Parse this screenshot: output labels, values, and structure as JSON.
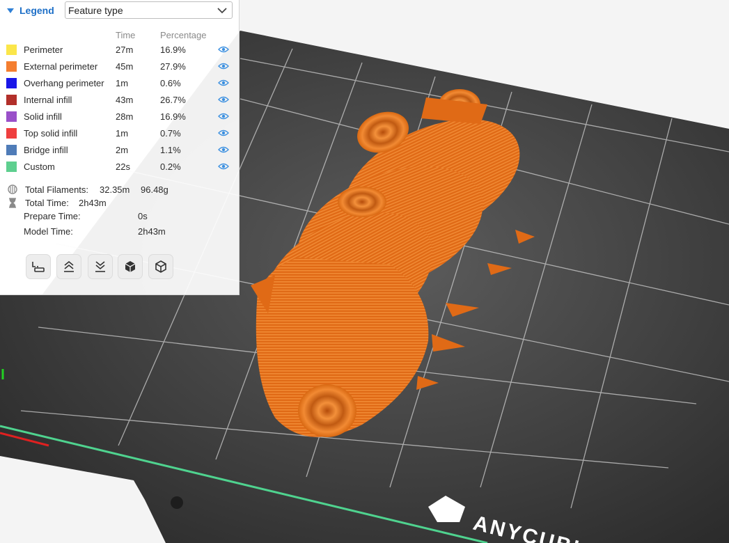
{
  "legend": {
    "title": "Legend",
    "view_type": "Feature type",
    "columns": {
      "time": "Time",
      "percentage": "Percentage"
    },
    "features": [
      {
        "name": "Perimeter",
        "time": "27m",
        "percent": "16.9%",
        "color": "#fbe64a"
      },
      {
        "name": "External perimeter",
        "time": "45m",
        "percent": "27.9%",
        "color": "#f47e2f"
      },
      {
        "name": "Overhang perimeter",
        "time": "1m",
        "percent": "0.6%",
        "color": "#1a16e8"
      },
      {
        "name": "Internal infill",
        "time": "43m",
        "percent": "26.7%",
        "color": "#b22f2a"
      },
      {
        "name": "Solid infill",
        "time": "28m",
        "percent": "16.9%",
        "color": "#9a50c9"
      },
      {
        "name": "Top solid infill",
        "time": "1m",
        "percent": "0.7%",
        "color": "#ef3f3f"
      },
      {
        "name": "Bridge infill",
        "time": "2m",
        "percent": "1.1%",
        "color": "#4f7cb8"
      },
      {
        "name": "Custom",
        "time": "22s",
        "percent": "0.2%",
        "color": "#5ecf8f"
      }
    ],
    "stats": {
      "filaments_label": "Total Filaments:",
      "filaments_length": "32.35m",
      "filaments_weight": "96.48g",
      "total_time_label": "Total Time:",
      "total_time": "2h43m",
      "prepare_time_label": "Prepare Time:",
      "prepare_time": "0s",
      "model_time_label": "Model Time:",
      "model_time": "2h43m"
    },
    "tools": [
      {
        "name": "layer-travel-icon"
      },
      {
        "name": "collapse-up-icon"
      },
      {
        "name": "expand-down-icon"
      },
      {
        "name": "solid-cube-icon"
      },
      {
        "name": "wireframe-cube-icon"
      }
    ]
  },
  "viewport": {
    "bed_brand": "ANYCUBIC",
    "model_color": "#e5711c",
    "accent_color": "#2f80d6"
  }
}
